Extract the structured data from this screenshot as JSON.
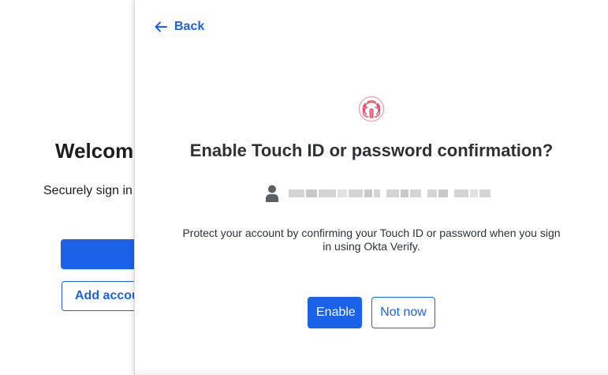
{
  "background_window": {
    "title": "Welcome",
    "subtitle": "Securely sign in",
    "secondary_button_label": "Add account"
  },
  "sheet": {
    "back_label": "Back",
    "title": "Enable Touch ID or password confirmation?",
    "description": "Protect your account by confirming your Touch ID or password when you sign in using Okta Verify.",
    "enable_label": "Enable",
    "not_now_label": "Not now"
  },
  "colors": {
    "accent": "#1a62e8",
    "fingerprint": "#e0405a",
    "text_dark": "#2d3237"
  },
  "icons": {
    "back": "arrow-left-icon",
    "fingerprint": "fingerprint-icon",
    "account": "person-icon"
  }
}
